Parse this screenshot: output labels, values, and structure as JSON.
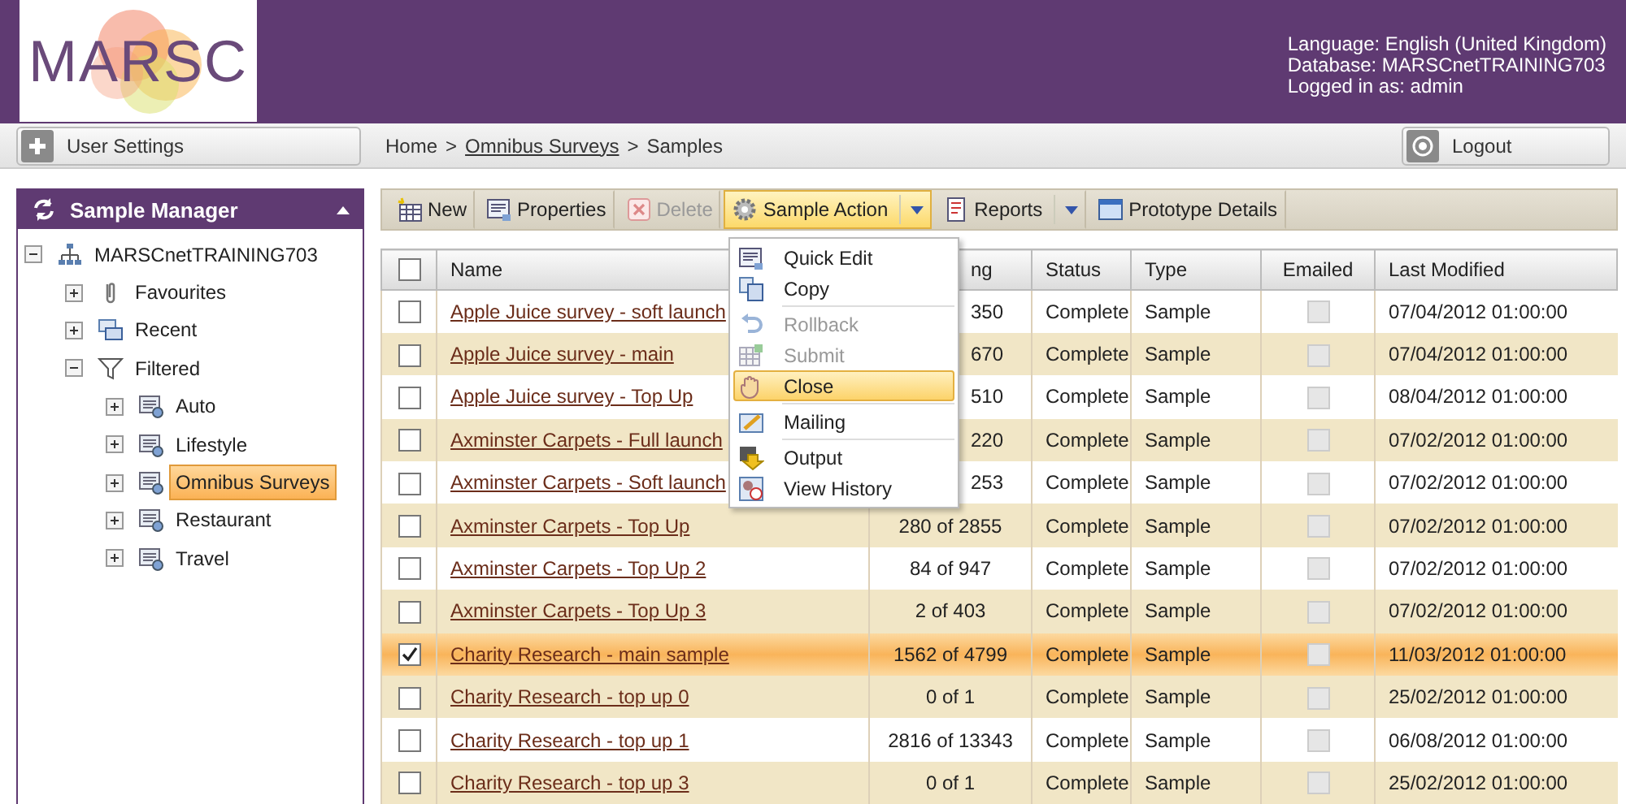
{
  "logo": {
    "text": "MARSC"
  },
  "session": [
    "Language: English (United Kingdom)",
    "Database: MARSCnetTRAINING703",
    "Logged in as: admin"
  ],
  "user_settings": {
    "label": "User Settings"
  },
  "breadcrumb": [
    {
      "label": "Home",
      "link": false
    },
    {
      "label": "Omnibus Surveys",
      "link": true
    },
    {
      "label": "Samples",
      "link": false
    }
  ],
  "breadcrumb_separator": ">",
  "logout": {
    "label": "Logout"
  },
  "sidebar": {
    "title": "Sample Manager",
    "tree": [
      {
        "label": "MARSCnetTRAINING703",
        "kind": "network",
        "expanded": true,
        "selected": false,
        "children": [
          {
            "label": "Favourites",
            "kind": "clip",
            "expanded": false,
            "selected": false
          },
          {
            "label": "Recent",
            "kind": "windows",
            "expanded": false,
            "selected": false
          },
          {
            "label": "Filtered",
            "kind": "funnel",
            "expanded": true,
            "selected": false,
            "children": [
              {
                "label": "Auto",
                "kind": "db",
                "expanded": false,
                "selected": false
              },
              {
                "label": "Lifestyle",
                "kind": "db",
                "expanded": false,
                "selected": false
              },
              {
                "label": "Omnibus Surveys",
                "kind": "db",
                "expanded": false,
                "selected": true
              },
              {
                "label": "Restaurant",
                "kind": "db",
                "expanded": false,
                "selected": false
              },
              {
                "label": "Travel",
                "kind": "db",
                "expanded": false,
                "selected": false
              }
            ]
          }
        ]
      }
    ]
  },
  "toolbar": [
    {
      "label": "New",
      "kind": "new",
      "disabled": false,
      "dropdown": false,
      "active": false
    },
    {
      "label": "Properties",
      "kind": "props",
      "disabled": false,
      "dropdown": false,
      "active": false
    },
    {
      "label": "Delete",
      "kind": "delete",
      "disabled": true,
      "dropdown": false,
      "active": false
    },
    {
      "label": "Sample Action",
      "kind": "gear",
      "disabled": false,
      "dropdown": true,
      "active": true
    },
    {
      "label": "Reports",
      "kind": "report",
      "disabled": false,
      "dropdown": true,
      "active": false
    },
    {
      "label": "Prototype Details",
      "kind": "window",
      "disabled": false,
      "dropdown": false,
      "active": false
    }
  ],
  "menu": [
    [
      {
        "label": "Quick Edit",
        "kind": "edit",
        "disabled": false,
        "selected": false
      },
      {
        "label": "Copy",
        "kind": "copy",
        "disabled": false,
        "selected": false
      }
    ],
    [
      {
        "label": "Rollback",
        "kind": "undo",
        "disabled": true,
        "selected": false
      },
      {
        "label": "Submit",
        "kind": "submit",
        "disabled": true,
        "selected": false
      },
      {
        "label": "Close",
        "kind": "hand",
        "disabled": false,
        "selected": true
      }
    ],
    [
      {
        "label": "Mailing",
        "kind": "mail",
        "disabled": false,
        "selected": false
      }
    ],
    [
      {
        "label": "Output",
        "kind": "output",
        "disabled": false,
        "selected": false
      },
      {
        "label": "View History",
        "kind": "history",
        "disabled": false,
        "selected": false
      }
    ]
  ],
  "table": {
    "header_checked": false,
    "columns": [
      "Name",
      "ng",
      "Status",
      "Type",
      "Emailed",
      "Last Modified"
    ],
    "rows": [
      {
        "checked": false,
        "selected": false,
        "name": "Apple Juice survey - soft launch",
        "count": "350",
        "count_covered": true,
        "status": "Complete",
        "type": "Sample",
        "emailed": false,
        "modified": "07/04/2012 01:00:00"
      },
      {
        "checked": false,
        "selected": false,
        "name": "Apple Juice survey - main",
        "count": "670",
        "count_covered": true,
        "status": "Complete",
        "type": "Sample",
        "emailed": false,
        "modified": "07/04/2012 01:00:00"
      },
      {
        "checked": false,
        "selected": false,
        "name": "Apple Juice survey - Top Up",
        "count": "510",
        "count_covered": true,
        "status": "Complete",
        "type": "Sample",
        "emailed": false,
        "modified": "08/04/2012 01:00:00"
      },
      {
        "checked": false,
        "selected": false,
        "name": "Axminster Carpets - Full launch",
        "count": "220",
        "count_covered": true,
        "status": "Complete",
        "type": "Sample",
        "emailed": false,
        "modified": "07/02/2012 01:00:00"
      },
      {
        "checked": false,
        "selected": false,
        "name": "Axminster Carpets - Soft launch",
        "count": "253",
        "count_covered": true,
        "status": "Complete",
        "type": "Sample",
        "emailed": false,
        "modified": "07/02/2012 01:00:00"
      },
      {
        "checked": false,
        "selected": false,
        "name": "Axminster Carpets - Top Up",
        "count": "280 of 2855",
        "count_covered": false,
        "status": "Complete",
        "type": "Sample",
        "emailed": false,
        "modified": "07/02/2012 01:00:00"
      },
      {
        "checked": false,
        "selected": false,
        "name": "Axminster Carpets - Top Up 2",
        "count": "84 of 947",
        "count_covered": false,
        "status": "Complete",
        "type": "Sample",
        "emailed": false,
        "modified": "07/02/2012 01:00:00"
      },
      {
        "checked": false,
        "selected": false,
        "name": "Axminster Carpets - Top Up 3",
        "count": "2 of 403",
        "count_covered": false,
        "status": "Complete",
        "type": "Sample",
        "emailed": false,
        "modified": "07/02/2012 01:00:00"
      },
      {
        "checked": true,
        "selected": true,
        "name": "Charity Research - main sample",
        "count": "1562 of 4799",
        "count_covered": false,
        "status": "Complete",
        "type": "Sample",
        "emailed": false,
        "modified": "11/03/2012 01:00:00"
      },
      {
        "checked": false,
        "selected": false,
        "name": "Charity Research - top up 0",
        "count": "0 of 1",
        "count_covered": false,
        "status": "Complete",
        "type": "Sample",
        "emailed": false,
        "modified": "25/02/2012 01:00:00"
      },
      {
        "checked": false,
        "selected": false,
        "name": "Charity Research - top up 1",
        "count": "2816 of 13343",
        "count_covered": false,
        "status": "Complete",
        "type": "Sample",
        "emailed": false,
        "modified": "06/08/2012 01:00:00"
      },
      {
        "checked": false,
        "selected": false,
        "name": "Charity Research - top up 3",
        "count": "0 of 1",
        "count_covered": false,
        "status": "Complete",
        "type": "Sample",
        "emailed": false,
        "modified": "25/02/2012 01:00:00"
      }
    ]
  }
}
